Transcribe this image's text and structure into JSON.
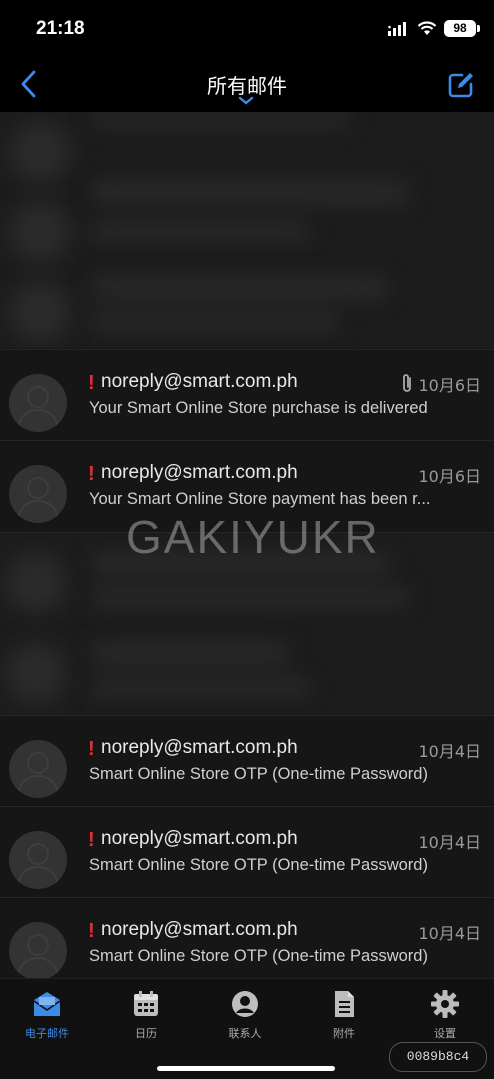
{
  "status_bar": {
    "time": "21:18",
    "battery": "98"
  },
  "nav": {
    "title": "所有邮件"
  },
  "emails": [
    {
      "sender": "noreply@smart.com.ph",
      "subject": "Your Smart Online Store purchase is delivered",
      "date": "10月6日",
      "has_attachment": true,
      "important": true
    },
    {
      "sender": "noreply@smart.com.ph",
      "subject": "Your Smart Online Store payment has been r...",
      "date": "10月6日",
      "has_attachment": false,
      "important": true
    },
    {
      "sender": "noreply@smart.com.ph",
      "subject": "Smart Online Store OTP (One-time Password)",
      "date": "10月4日",
      "has_attachment": false,
      "important": true
    },
    {
      "sender": "noreply@smart.com.ph",
      "subject": "Smart Online Store OTP (One-time Password)",
      "date": "10月4日",
      "has_attachment": false,
      "important": true
    },
    {
      "sender": "noreply@smart.com.ph",
      "subject": "Smart Online Store OTP (One-time Password)",
      "date": "10月4日",
      "has_attachment": false,
      "important": true
    }
  ],
  "flag_glyph": "!",
  "watermark": "GAKIYUKR",
  "tabs": [
    {
      "label": "电子邮件",
      "icon": "mail-icon"
    },
    {
      "label": "日历",
      "icon": "calendar-icon"
    },
    {
      "label": "联系人",
      "icon": "contact-icon"
    },
    {
      "label": "附件",
      "icon": "attachment-file-icon"
    },
    {
      "label": "设置",
      "icon": "gear-icon"
    }
  ],
  "active_tab": "电子邮件",
  "hash_badge": "0089b8c4",
  "colors": {
    "accent": "#3d8be8",
    "important": "#e0303a",
    "background": "#161616"
  }
}
